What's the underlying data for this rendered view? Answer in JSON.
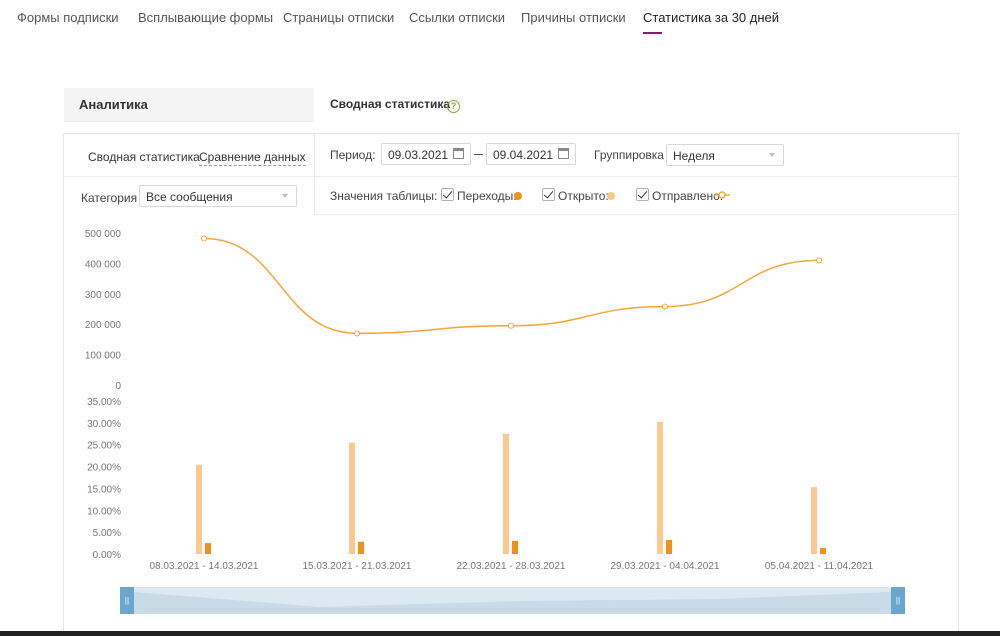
{
  "nav": {
    "tabs": [
      {
        "label": "Формы подписки"
      },
      {
        "label": "Всплывающие формы"
      },
      {
        "label": "Страницы отписки"
      },
      {
        "label": "Ссылки отписки"
      },
      {
        "label": "Причины отписки"
      },
      {
        "label": "Статистика за 30 дней",
        "active": true
      }
    ]
  },
  "left_panel": {
    "title": "Аналитика"
  },
  "right_panel": {
    "title": "Сводная статистика",
    "help": "?"
  },
  "modes": {
    "summary": "Сводная статистика",
    "compare": "Сравнение данных"
  },
  "filters": {
    "period_label": "Период:",
    "date_from": "09.03.2021",
    "date_to": "09.04.2021",
    "grouping_label": "Группировка",
    "grouping_value": "Неделя",
    "category_label": "Категория",
    "category_value": "Все сообщения"
  },
  "table_values": {
    "label": "Значения таблицы:",
    "items": [
      {
        "label": "Переходы:",
        "checked": true
      },
      {
        "label": "Открыто:",
        "checked": true
      },
      {
        "label": "Отправлено:",
        "checked": true
      }
    ]
  },
  "colors": {
    "clicks": "#f0901e",
    "opened": "#fbc98e",
    "sent": "#f5a53a",
    "navigator": "#dde9f1",
    "navigator_handle": "#6aa6cd",
    "active_tab_underline": "#8a1a6e"
  },
  "chart_data": [
    {
      "type": "line",
      "series_name": "Отправлено",
      "ylim": [
        0,
        500000
      ],
      "yticks": [
        "500 000",
        "400 000",
        "300 000",
        "200 000",
        "100 000",
        "0"
      ],
      "tick_values": [
        500000,
        400000,
        300000,
        200000,
        100000,
        0
      ],
      "values": [
        482000,
        170000,
        195000,
        258000,
        410000
      ]
    },
    {
      "type": "bar",
      "ylim": [
        0,
        35
      ],
      "yticks": [
        "35.00%",
        "30.00%",
        "25.00%",
        "20.00%",
        "15.00%",
        "10.00%",
        "5.00%",
        "0.00%"
      ],
      "tick_values": [
        35,
        30,
        25,
        20,
        15,
        10,
        5,
        0
      ],
      "categories": [
        "08.03.2021 - 14.03.2021",
        "15.03.2021 - 21.03.2021",
        "22.03.2021 - 28.03.2021",
        "29.03.2021 - 04.04.2021",
        "05.04.2021 - 11.04.2021"
      ],
      "series": [
        {
          "name": "Открыто",
          "values": [
            20.4,
            25.5,
            27.5,
            30.2,
            15.3
          ]
        },
        {
          "name": "Переходы",
          "values": [
            2.5,
            2.8,
            3.0,
            3.2,
            1.4
          ]
        }
      ]
    }
  ]
}
